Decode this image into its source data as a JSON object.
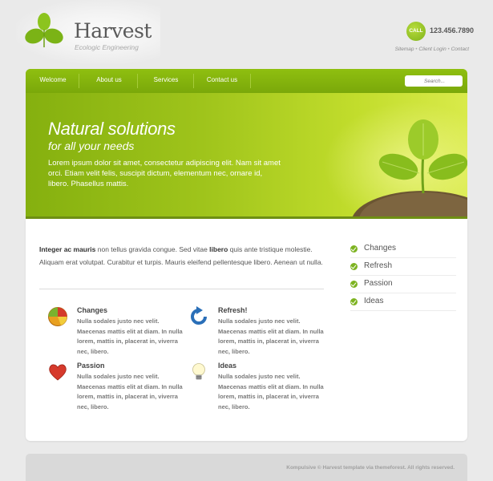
{
  "header": {
    "logo_title": "Harvest",
    "logo_subtitle": "Ecologic Engineering",
    "call_label": "CALL",
    "phone": "123.456.7890",
    "links": [
      "Sitemap",
      "Client Login",
      "Contact"
    ],
    "link_separator": " • "
  },
  "nav": {
    "items": [
      "Welcome",
      "About us",
      "Services",
      "Contact us"
    ],
    "search_placeholder": "Search..."
  },
  "hero": {
    "title": "Natural solutions",
    "subtitle": "for all your needs",
    "text": "Lorem ipsum dolor sit amet, consectetur adipiscing elit. Nam sit amet orci. Etiam velit felis, suscipit dictum, elementum nec, ornare id, libero. Phasellus mattis."
  },
  "intro": {
    "lead_bold": "Integer ac mauris",
    "part1": " non tellus gravida congue. Sed vitae ",
    "bold2": "libero",
    "part2": " quis ante tristique molestie. Aliquam erat volutpat. Curabitur et turpis. Mauris eleifend pellentesque libero. Aenean ut nulla."
  },
  "features": [
    {
      "title": "Changes",
      "icon": "pie-chart-icon",
      "text": "Nulla sodales justo nec velit. Maecenas mattis elit at diam. In nulla lorem, mattis in, placerat in, viverra nec, libero."
    },
    {
      "title": "Refresh!",
      "icon": "refresh-icon",
      "text": "Nulla sodales justo nec velit. Maecenas mattis elit at diam. In nulla lorem, mattis in, placerat in, viverra nec, libero."
    },
    {
      "title": "Passion",
      "icon": "heart-icon",
      "text": "Nulla sodales justo nec velit. Maecenas mattis elit at diam. In nulla lorem, mattis in, placerat in, viverra nec, libero."
    },
    {
      "title": "Ideas",
      "icon": "lightbulb-icon",
      "text": "Nulla sodales justo nec velit. Maecenas mattis elit at diam. In nulla lorem, mattis in, placerat in, viverra nec, libero."
    }
  ],
  "sidebar": {
    "items": [
      "Changes",
      "Refresh",
      "Passion",
      "Ideas"
    ]
  },
  "footer": {
    "text": "Kompulsive © Harvest template via themeforest. All rights reserved."
  },
  "colors": {
    "accent": "#8fbf10",
    "accent_dark": "#7aa80a",
    "check_green": "#7db321",
    "background": "#eaeaea"
  }
}
